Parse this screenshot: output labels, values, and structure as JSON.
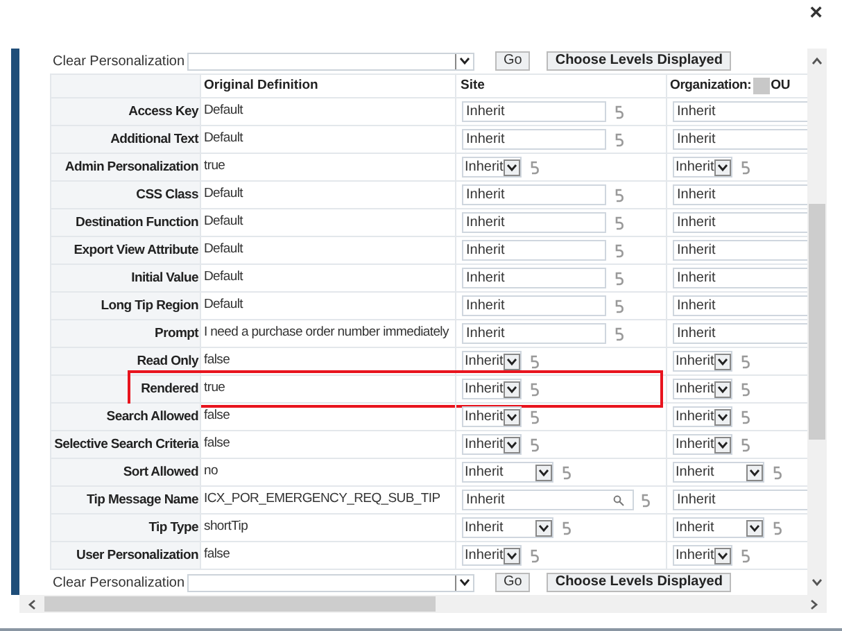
{
  "dialog": {
    "close": "×"
  },
  "toolbar_top": {
    "label": "Clear Personalization",
    "go": "Go",
    "choose": "Choose Levels Displayed"
  },
  "table": {
    "columns": [
      "Original Definition",
      "Site"
    ],
    "org_column": {
      "label": "Organization:",
      "suffix": "OU"
    },
    "rows": [
      {
        "label": "Access Key",
        "original": "Default",
        "kind": "text",
        "site": "Inherit",
        "organization": "Inherit",
        "highlighted": false
      },
      {
        "label": "Additional Text",
        "original": "Default",
        "kind": "text",
        "site": "Inherit",
        "organization": "Inherit",
        "highlighted": false
      },
      {
        "label": "Admin Personalization",
        "original": "true",
        "kind": "select",
        "site": "Inherit",
        "organization": "Inherit",
        "highlighted": false
      },
      {
        "label": "CSS Class",
        "original": "Default",
        "kind": "text",
        "site": "Inherit",
        "organization": "Inherit",
        "highlighted": false
      },
      {
        "label": "Destination Function",
        "original": "Default",
        "kind": "text",
        "site": "Inherit",
        "organization": "Inherit",
        "highlighted": false
      },
      {
        "label": "Export View Attribute",
        "original": "Default",
        "kind": "text",
        "site": "Inherit",
        "organization": "Inherit",
        "highlighted": false
      },
      {
        "label": "Initial Value",
        "original": "Default",
        "kind": "text",
        "site": "Inherit",
        "organization": "Inherit",
        "highlighted": false
      },
      {
        "label": "Long Tip Region",
        "original": "Default",
        "kind": "text",
        "site": "Inherit",
        "organization": "Inherit",
        "highlighted": false
      },
      {
        "label": "Prompt",
        "original": "I need a purchase order number immediately",
        "kind": "text",
        "site": "Inherit",
        "organization": "Inherit",
        "highlighted": false
      },
      {
        "label": "Read Only",
        "original": "false",
        "kind": "select",
        "site": "Inherit",
        "organization": "Inherit",
        "highlighted": false
      },
      {
        "label": "Rendered",
        "original": "true",
        "kind": "select",
        "site": "Inherit",
        "organization": "Inherit",
        "highlighted": true
      },
      {
        "label": "Search Allowed",
        "original": "false",
        "kind": "select",
        "site": "Inherit",
        "organization": "Inherit",
        "highlighted": false
      },
      {
        "label": "Selective Search Criteria",
        "original": "false",
        "kind": "select",
        "site": "Inherit",
        "organization": "Inherit",
        "highlighted": false
      },
      {
        "label": "Sort Allowed",
        "original": "no",
        "kind": "wideselect",
        "site": "Inherit",
        "organization": "Inherit",
        "highlighted": false
      },
      {
        "label": "Tip Message Name",
        "original": "ICX_POR_EMERGENCY_REQ_SUB_TIP",
        "kind": "lov",
        "site": "Inherit",
        "organization": "Inherit",
        "highlighted": false
      },
      {
        "label": "Tip Type",
        "original": "shortTip",
        "kind": "wideselect",
        "site": "Inherit",
        "organization": "Inherit",
        "highlighted": false
      },
      {
        "label": "User Personalization",
        "original": "false",
        "kind": "select",
        "site": "Inherit",
        "organization": "Inherit",
        "highlighted": false
      }
    ]
  },
  "toolbar_bottom": {
    "label": "Clear Personalization",
    "go": "Go",
    "choose": "Choose Levels Displayed"
  }
}
